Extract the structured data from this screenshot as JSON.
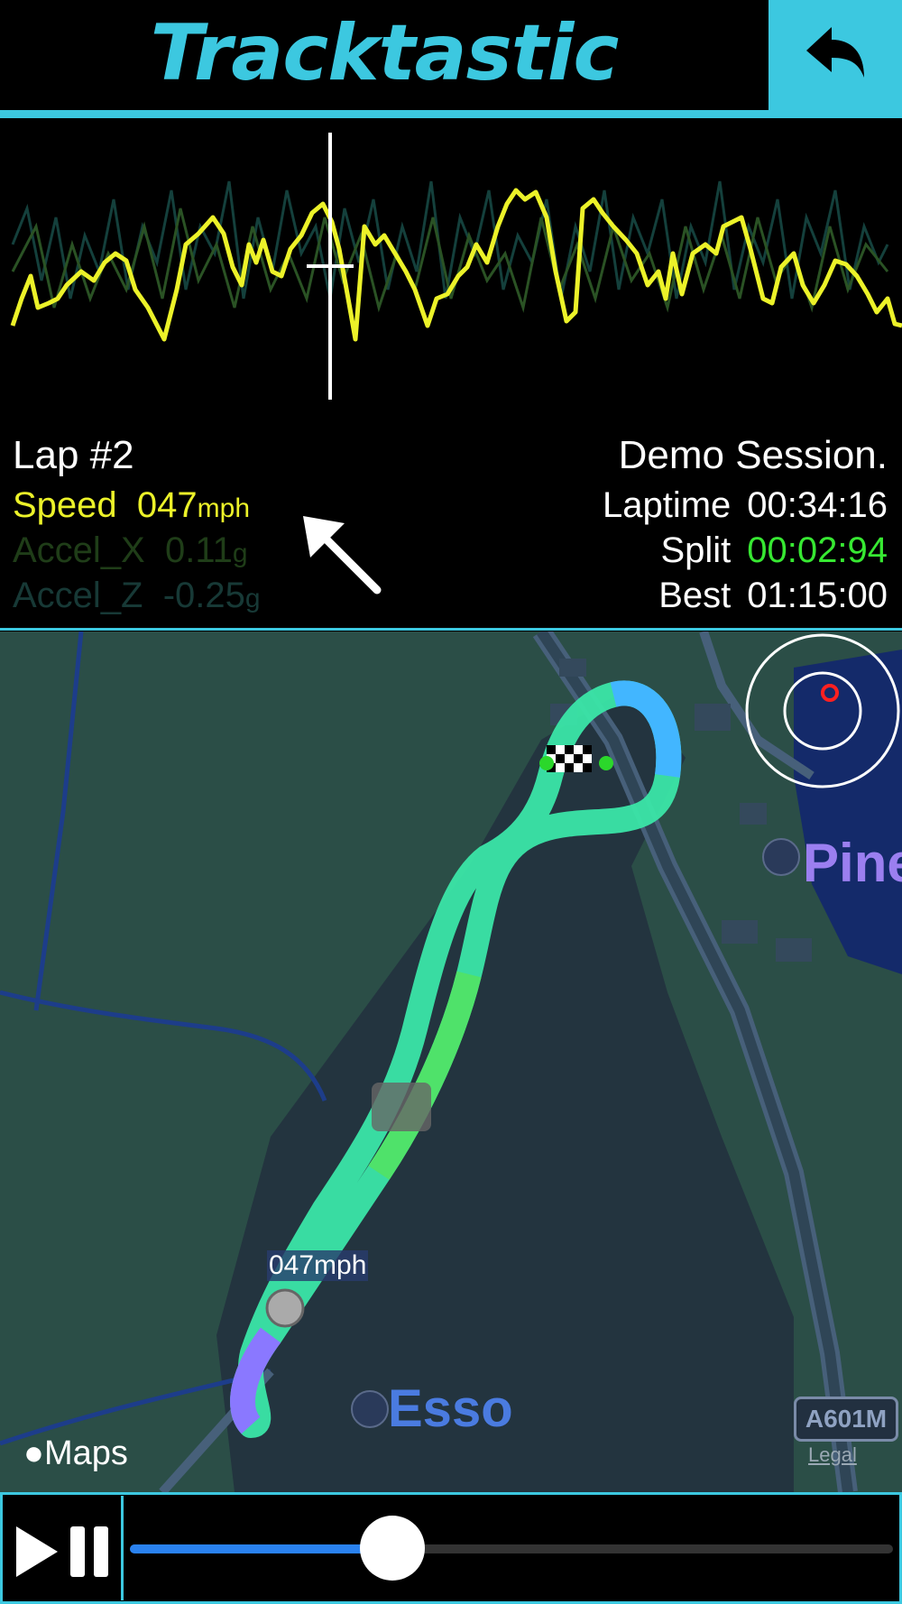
{
  "header": {
    "title": "Tracktastic"
  },
  "lap": {
    "title": "Lap #2"
  },
  "channels": {
    "speed": {
      "label": "Speed",
      "value": "047",
      "unit": "mph"
    },
    "accel_x": {
      "label": "Accel_X",
      "value": "0.11",
      "unit": "g"
    },
    "accel_z": {
      "label": "Accel_Z",
      "value": "-0.25",
      "unit": "g"
    }
  },
  "session": {
    "name": "Demo Session.",
    "laptime_label": "Laptime",
    "laptime": "00:34:16",
    "split_label": "Split",
    "split": "00:02:94",
    "best_label": "Best",
    "best": "01:15:00"
  },
  "map": {
    "poi_pine": "Pine",
    "poi_esso": "Esso",
    "road_badge": "A601M",
    "maps_logo": "Maps",
    "legal": "Legal",
    "speed_marker": "047mph"
  },
  "playback": {
    "progress": 0.33
  },
  "colors": {
    "accent": "#3cc8e0",
    "speed": "#ecf229",
    "split": "#37e832"
  }
}
